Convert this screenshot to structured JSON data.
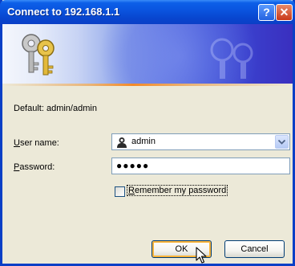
{
  "window": {
    "title": "Connect to 192.168.1.1",
    "help_glyph": "?",
    "close_glyph": "✕"
  },
  "dialog": {
    "default_text": "Default: admin/admin",
    "username": {
      "label_key": "U",
      "label_rest": "ser name:",
      "value": "admin",
      "icon": "user-icon"
    },
    "password": {
      "label_key": "P",
      "label_rest": "assword:",
      "masked_value": "●●●●●"
    },
    "remember": {
      "label_key": "R",
      "label_rest": "emember my password",
      "checked": false
    },
    "buttons": {
      "ok": "OK",
      "cancel": "Cancel"
    }
  },
  "colors": {
    "title_bar": "#0a55e0",
    "face": "#ece9d8",
    "accent_line": "#f28a2a",
    "close": "#c9391a"
  }
}
